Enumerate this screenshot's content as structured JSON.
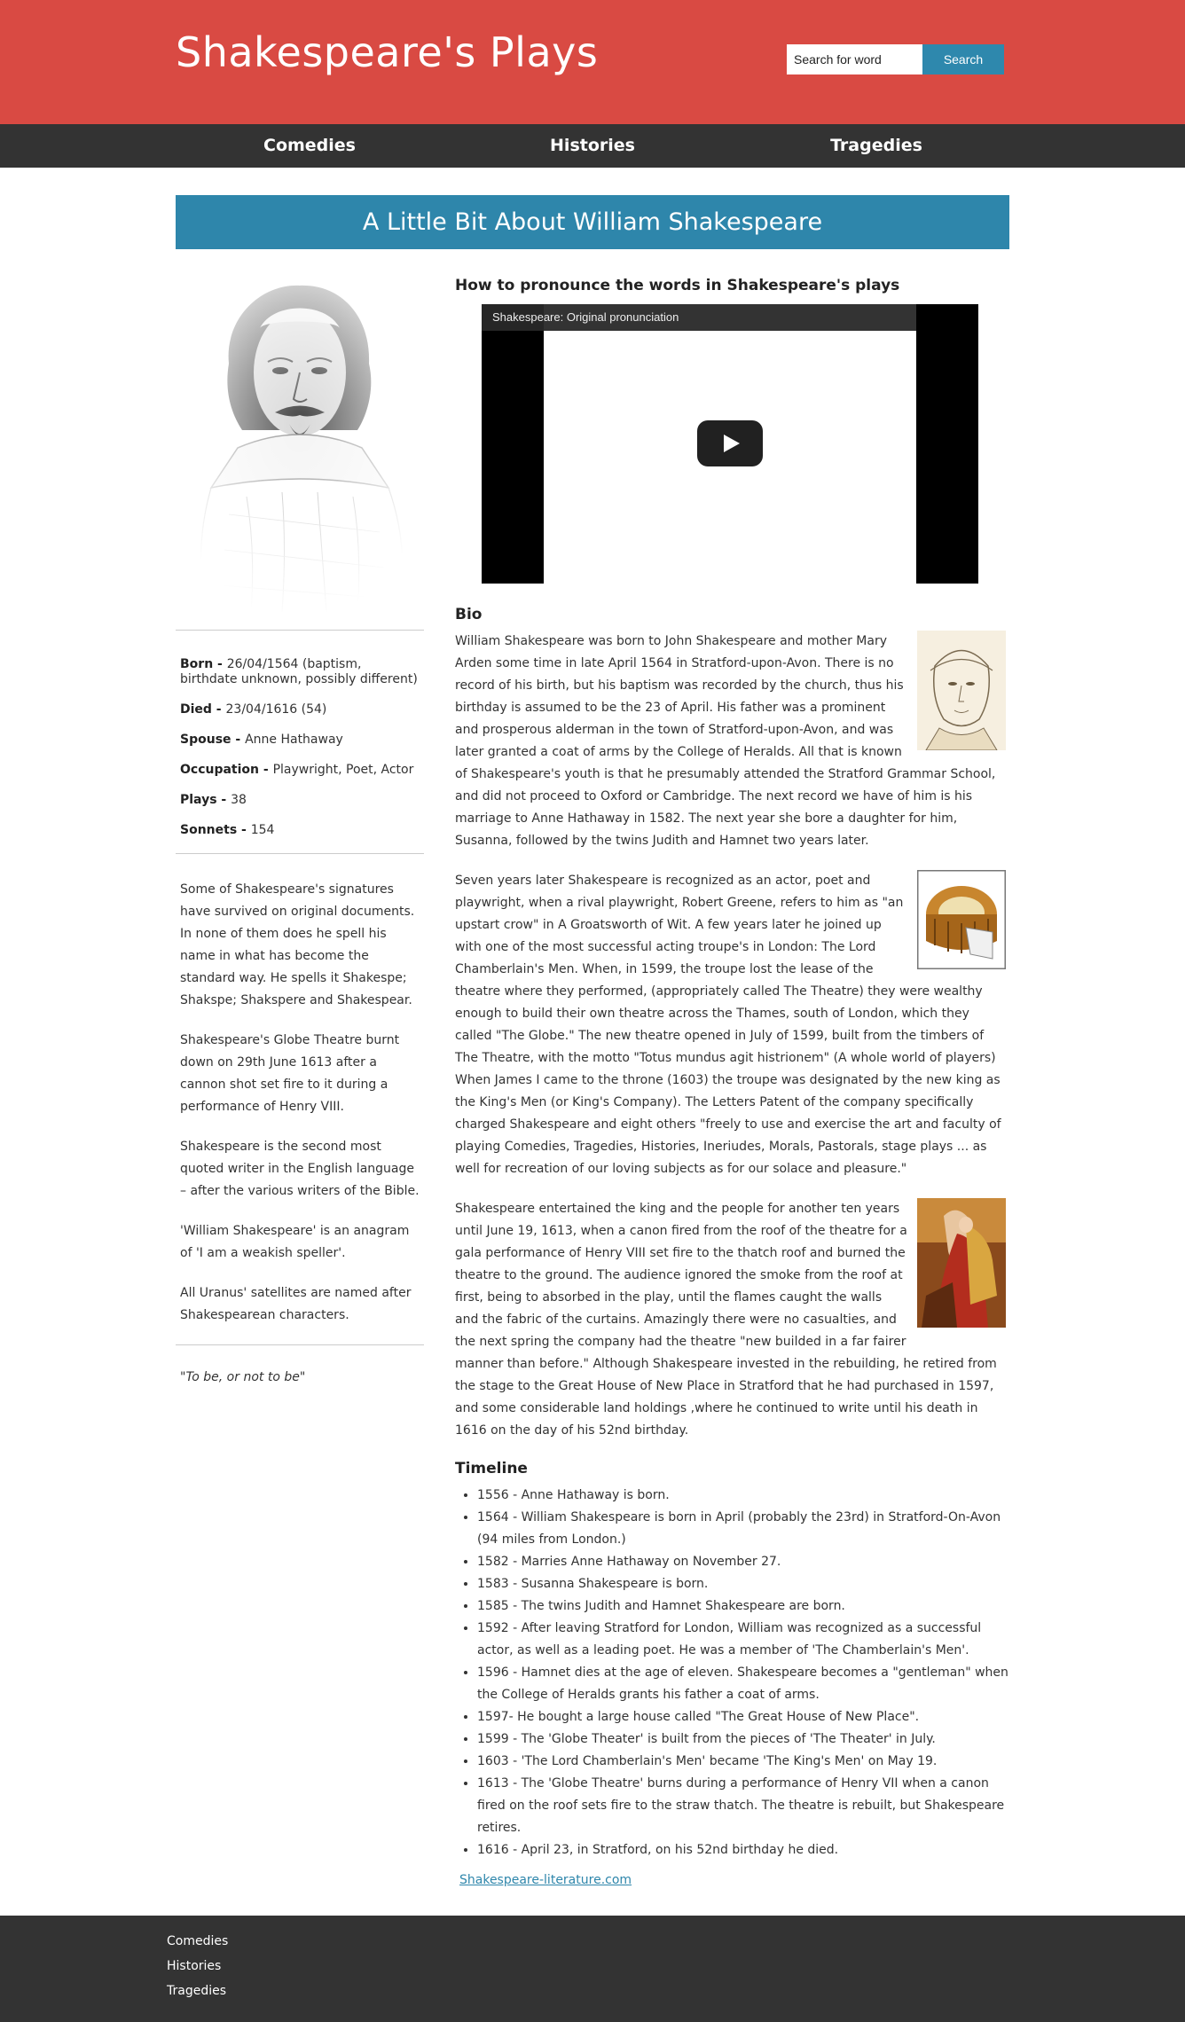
{
  "header": {
    "title": "Shakespeare's Plays",
    "search_value": "Search for word",
    "search_button": "Search"
  },
  "nav": {
    "items": [
      "Comedies",
      "Histories",
      "Tragedies"
    ]
  },
  "banner": "A Little Bit About William Shakespeare",
  "facts": [
    {
      "label": "Born - ",
      "value": "26/04/1564 (baptism, birthdate unknown, possibly different)"
    },
    {
      "label": "Died - ",
      "value": "23/04/1616 (54)"
    },
    {
      "label": "Spouse - ",
      "value": "Anne Hathaway"
    },
    {
      "label": "Occupation - ",
      "value": "Playwright, Poet, Actor"
    },
    {
      "label": "Plays - ",
      "value": "38"
    },
    {
      "label": "Sonnets - ",
      "value": "154"
    }
  ],
  "notes": [
    "Some of Shakespeare's signatures have survived on original documents. In none of them does he spell his name in what has become the standard way. He spells it Shakespe; Shakspe; Shakspere and Shakespear.",
    "Shakespeare's Globe Theatre burnt down on 29th June 1613 after a cannon shot set fire to it during a performance of Henry VIII.",
    "Shakespeare is the second most quoted writer in the English language – after the various writers of the Bible.",
    "'William Shakespeare' is an anagram of 'I am a weakish speller'.",
    "All Uranus' satellites are named after Shakespearean characters."
  ],
  "quote": "\"To be, or not to be\"",
  "pronounce_heading": "How to pronounce the words in Shakespeare's plays",
  "video_title": "Shakespeare: Original pronunciation",
  "bio_heading": "Bio",
  "bio": [
    "William Shakespeare was born to John Shakespeare and mother Mary Arden some time in late April 1564 in Stratford-upon-Avon. There is no record of his birth, but his baptism was recorded by the church, thus his birthday is assumed to be the 23 of April. His father was a prominent and prosperous alderman in the town of Stratford-upon-Avon, and was later granted a coat of arms by the College of Heralds. All that is known of Shakespeare's youth is that he presumably attended the Stratford Grammar School, and did not proceed to Oxford or Cambridge. The next record we have of him is his marriage to Anne Hathaway in 1582. The next year she bore a daughter for him, Susanna, followed by the twins Judith and Hamnet two years later.",
    "Seven years later Shakespeare is recognized as an actor, poet and playwright, when a rival playwright, Robert Greene, refers to him as \"an upstart crow\" in A Groatsworth of Wit. A few years later he joined up with one of the most successful acting troupe's in London: The Lord Chamberlain's Men. When, in 1599, the troupe lost the lease of the theatre where they performed, (appropriately called The Theatre) they were wealthy enough to build their own theatre across the Thames, south of London, which they called \"The Globe.\" The new theatre opened in July of 1599, built from the timbers of The Theatre, with the motto \"Totus mundus agit histrionem\" (A whole world of players) When James I came to the throne (1603) the troupe was designated by the new king as the King's Men (or King's Company). The Letters Patent of the company specifically charged Shakespeare and eight others \"freely to use and exercise the art and faculty of playing Comedies, Tragedies, Histories, Ineriudes, Morals, Pastorals, stage plays ... as well for recreation of our loving subjects as for our solace and pleasure.\"",
    "Shakespeare entertained the king and the people for another ten years until June 19, 1613, when a canon fired from the roof of the theatre for a gala performance of Henry VIII set fire to the thatch roof and burned the theatre to the ground. The audience ignored the smoke from the roof at first, being to absorbed in the play, until the flames caught the walls and the fabric of the curtains. Amazingly there were no casualties, and the next spring the company had the theatre \"new builded in a far fairer manner than before.\" Although Shakespeare invested in the rebuilding, he retired from the stage to the Great House of New Place in Stratford that he had purchased in 1597, and some considerable land holdings ,where he continued to write until his death in 1616 on the day of his 52nd birthday."
  ],
  "timeline_heading": "Timeline",
  "timeline": [
    "1556 - Anne Hathaway is born.",
    "1564 - William Shakespeare is born in April (probably the 23rd) in Stratford-On-Avon (94 miles from London.)",
    "1582 - Marries Anne Hathaway on November 27.",
    "1583 - Susanna Shakespeare is born.",
    "1585 - The twins Judith and Hamnet Shakespeare are born.",
    "1592 - After leaving Stratford for London, William was recognized as a successful actor, as well as a leading poet. He was a member of 'The Chamberlain's Men'.",
    "1596 - Hamnet dies at the age of eleven. Shakespeare becomes a \"gentleman\" when the College of Heralds grants his father a coat of arms.",
    "1597- He bought a large house called \"The Great House of New Place\".",
    "1599 - The 'Globe Theater' is built from the pieces of 'The Theater' in July.",
    "1603 - 'The Lord Chamberlain's Men' became 'The King's Men' on May 19.",
    "1613 - The 'Globe Theatre' burns during a performance of Henry VII when a canon fired on the roof sets fire to the straw thatch. The theatre is rebuilt, but Shakespeare retires.",
    "1616 - April 23, in Stratford, on his 52nd birthday he died."
  ],
  "source_link": "Shakespeare-literature.com",
  "footer": {
    "links": [
      "Comedies",
      "Histories",
      "Tragedies"
    ]
  }
}
